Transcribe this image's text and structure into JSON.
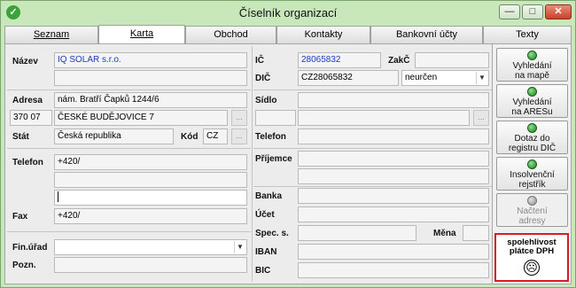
{
  "window": {
    "title": "Číselník organizací",
    "min_label": "—",
    "max_label": "□",
    "close_label": "✕"
  },
  "tabs": [
    {
      "label": "Seznam"
    },
    {
      "label": "Karta"
    },
    {
      "label": "Obchod"
    },
    {
      "label": "Kontakty"
    },
    {
      "label": "Bankovní účty"
    },
    {
      "label": "Texty"
    }
  ],
  "form": {
    "nazev_label": "Název",
    "nazev_value": "IQ SOLAR s.r.o.",
    "nazev2_value": "",
    "adresa_label": "Adresa",
    "ulice_value": "nám. Bratří Čapků 1244/6",
    "psc_value": "370 07",
    "mesto_value": "ČESKÉ BUDĚJOVICE 7",
    "stat_label": "Stát",
    "stat_value": "Česká republika",
    "kod_label": "Kód",
    "kod_value": "CZ",
    "telefon_label": "Telefon",
    "telefon_value": "+420/",
    "fax_label": "Fax",
    "fax_value": "+420/",
    "finurad_label": "Fin.úřad",
    "finurad_value": "",
    "pozn_label": "Pozn.",
    "pozn_value": "",
    "ic_label": "IČ",
    "ic_value": "28065832",
    "zakc_label": "ZakČ",
    "zakc_value": "",
    "dic_label": "DIČ",
    "dic_value": "CZ28065832",
    "dic_status": "neurčen",
    "sidlo_label": "Sídlo",
    "telefon2_label": "Telefon",
    "prijemce_label": "Příjemce",
    "banka_label": "Banka",
    "ucet_label": "Účet",
    "spec_label": "Spec. s.",
    "mena_label": "Měna",
    "iban_label": "IBAN",
    "bic_label": "BIC",
    "dots": "..."
  },
  "side": {
    "btn_mapa": [
      "Vyhledání",
      "na mapě"
    ],
    "btn_ares": [
      "Vyhledání",
      "na ARESu"
    ],
    "btn_dic": [
      "Dotaz do",
      "registru DIČ"
    ],
    "btn_insolv": [
      "Insolvenční",
      "rejstřík"
    ],
    "btn_nacteni": [
      "Načtení",
      "adresy"
    ],
    "dph_title": [
      "spolehlivost",
      "plátce DPH"
    ],
    "dph_face": "☹"
  },
  "colors": {
    "window_bg": "#c8e7ba",
    "accent_blue": "#1a3cc6",
    "dph_border": "#d32020"
  }
}
